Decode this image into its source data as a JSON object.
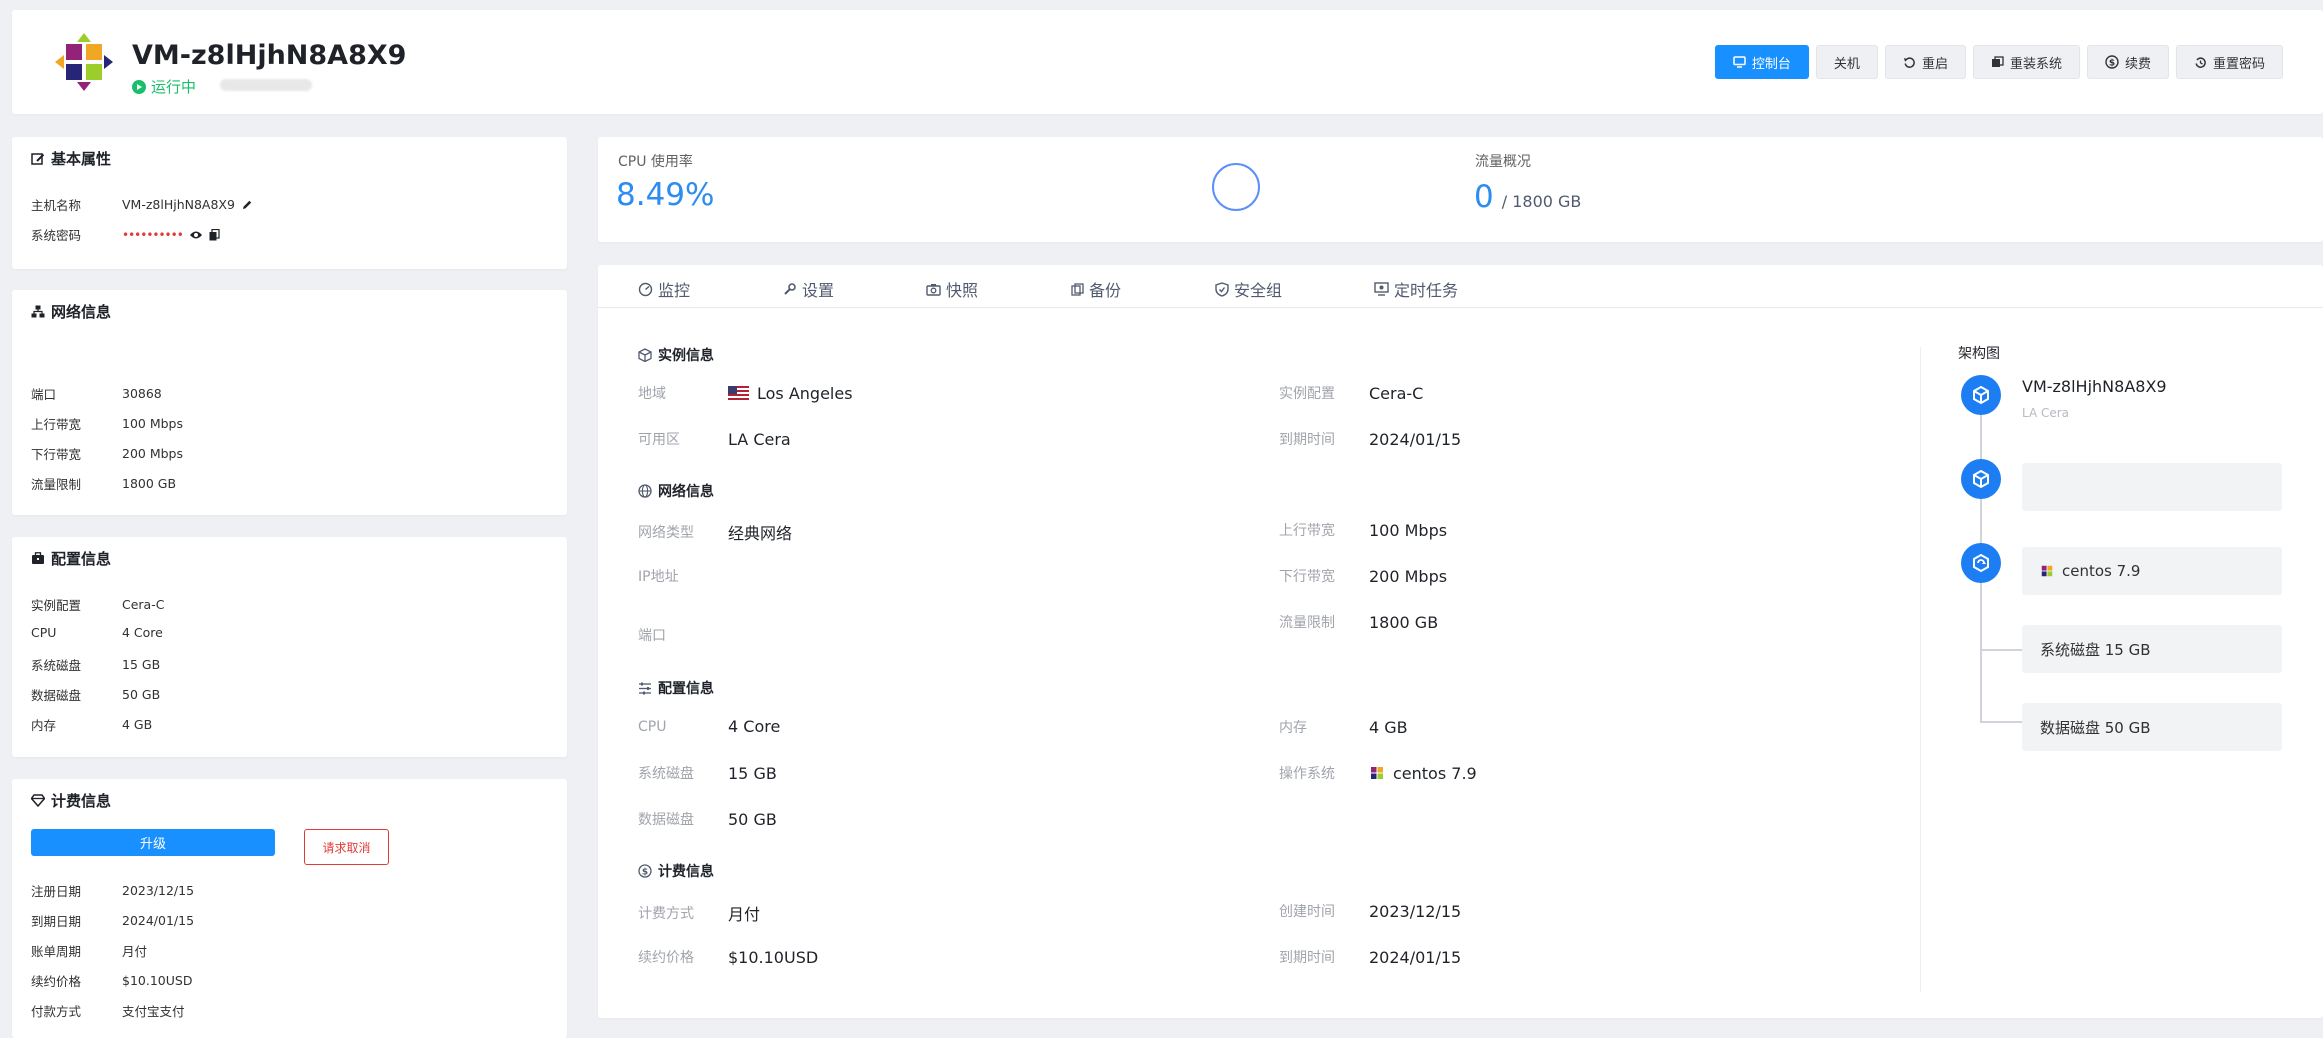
{
  "header": {
    "vm_name": "VM-z8lHjhN8A8X9",
    "status": "运行中",
    "actions": [
      {
        "label": "控制台",
        "icon": "monitor-icon"
      },
      {
        "label": "关机",
        "icon": ""
      },
      {
        "label": "重启",
        "icon": "restart-icon"
      },
      {
        "label": "重装系统",
        "icon": "reinstall-icon"
      },
      {
        "label": "续费",
        "icon": "dollar-icon"
      },
      {
        "label": "重置密码",
        "icon": "reset-icon"
      }
    ]
  },
  "basic": {
    "title": "基本属性",
    "hostname_label": "主机名称",
    "hostname": "VM-z8lHjhN8A8X9",
    "password_label": "系统密码",
    "password_mask": "••••••••••"
  },
  "network": {
    "title": "网络信息",
    "rows": [
      {
        "k": "端口",
        "v": "30868"
      },
      {
        "k": "上行带宽",
        "v": "100 Mbps"
      },
      {
        "k": "下行带宽",
        "v": "200 Mbps"
      },
      {
        "k": "流量限制",
        "v": "1800 GB"
      }
    ]
  },
  "config": {
    "title": "配置信息",
    "rows": [
      {
        "k": "实例配置",
        "v": "Cera-C"
      },
      {
        "k": "CPU",
        "v": "4 Core"
      },
      {
        "k": "系统磁盘",
        "v": "15 GB"
      },
      {
        "k": "数据磁盘",
        "v": "50 GB"
      },
      {
        "k": "内存",
        "v": "4 GB"
      }
    ]
  },
  "billing": {
    "title": "计费信息",
    "upgrade": "升级",
    "cancel": "请求取消",
    "rows": [
      {
        "k": "注册日期",
        "v": "2023/12/15"
      },
      {
        "k": "到期日期",
        "v": "2024/01/15"
      },
      {
        "k": "账单周期",
        "v": "月付"
      },
      {
        "k": "续约价格",
        "v": "$10.10USD"
      },
      {
        "k": "付款方式",
        "v": "支付宝支付"
      }
    ]
  },
  "stats": {
    "cpu_label": "CPU 使用率",
    "cpu_value": "8.49%",
    "traffic_label": "流量概况",
    "traffic_used": "0",
    "traffic_total": "/ 1800 GB"
  },
  "tabs": [
    "监控",
    "设置",
    "快照",
    "备份",
    "安全组",
    "定时任务"
  ],
  "detail": {
    "instance_title": "实例信息",
    "region_label": "地域",
    "region": "Los Angeles",
    "zone_label": "可用区",
    "zone": "LA Cera",
    "plan_label": "实例配置",
    "plan": "Cera-C",
    "expire_label": "到期时间",
    "expire": "2024/01/15",
    "net_title": "网络信息",
    "net_type_label": "网络类型",
    "net_type": "经典网络",
    "ip_label": "IP地址",
    "port_label": "端口",
    "up_label": "上行带宽",
    "up": "100 Mbps",
    "down_label": "下行带宽",
    "down": "200 Mbps",
    "traffic_label": "流量限制",
    "traffic": "1800 GB",
    "cfg_title": "配置信息",
    "cpu_label": "CPU",
    "cpu": "4 Core",
    "mem_label": "内存",
    "mem": "4 GB",
    "sysdisk_label": "系统磁盘",
    "sysdisk": "15 GB",
    "os_label": "操作系统",
    "os": "centos 7.9",
    "datadisk_label": "数据磁盘",
    "datadisk": "50 GB",
    "bill_title": "计费信息",
    "method_label": "计费方式",
    "method": "月付",
    "created_label": "创建时间",
    "created": "2023/12/15",
    "price_label": "续约价格",
    "price": "$10.10USD",
    "expire2_label": "到期时间",
    "expire2": "2024/01/15"
  },
  "arch": {
    "title": "架构图",
    "vm": "VM-z8lHjhN8A8X9",
    "zone": "LA Cera",
    "os": "centos 7.9",
    "sysdisk": "系统磁盘 15 GB",
    "datadisk": "数据磁盘 50 GB"
  },
  "colors": {
    "primary": "#1890ff",
    "running": "#19be6b",
    "danger": "#e23c39"
  }
}
